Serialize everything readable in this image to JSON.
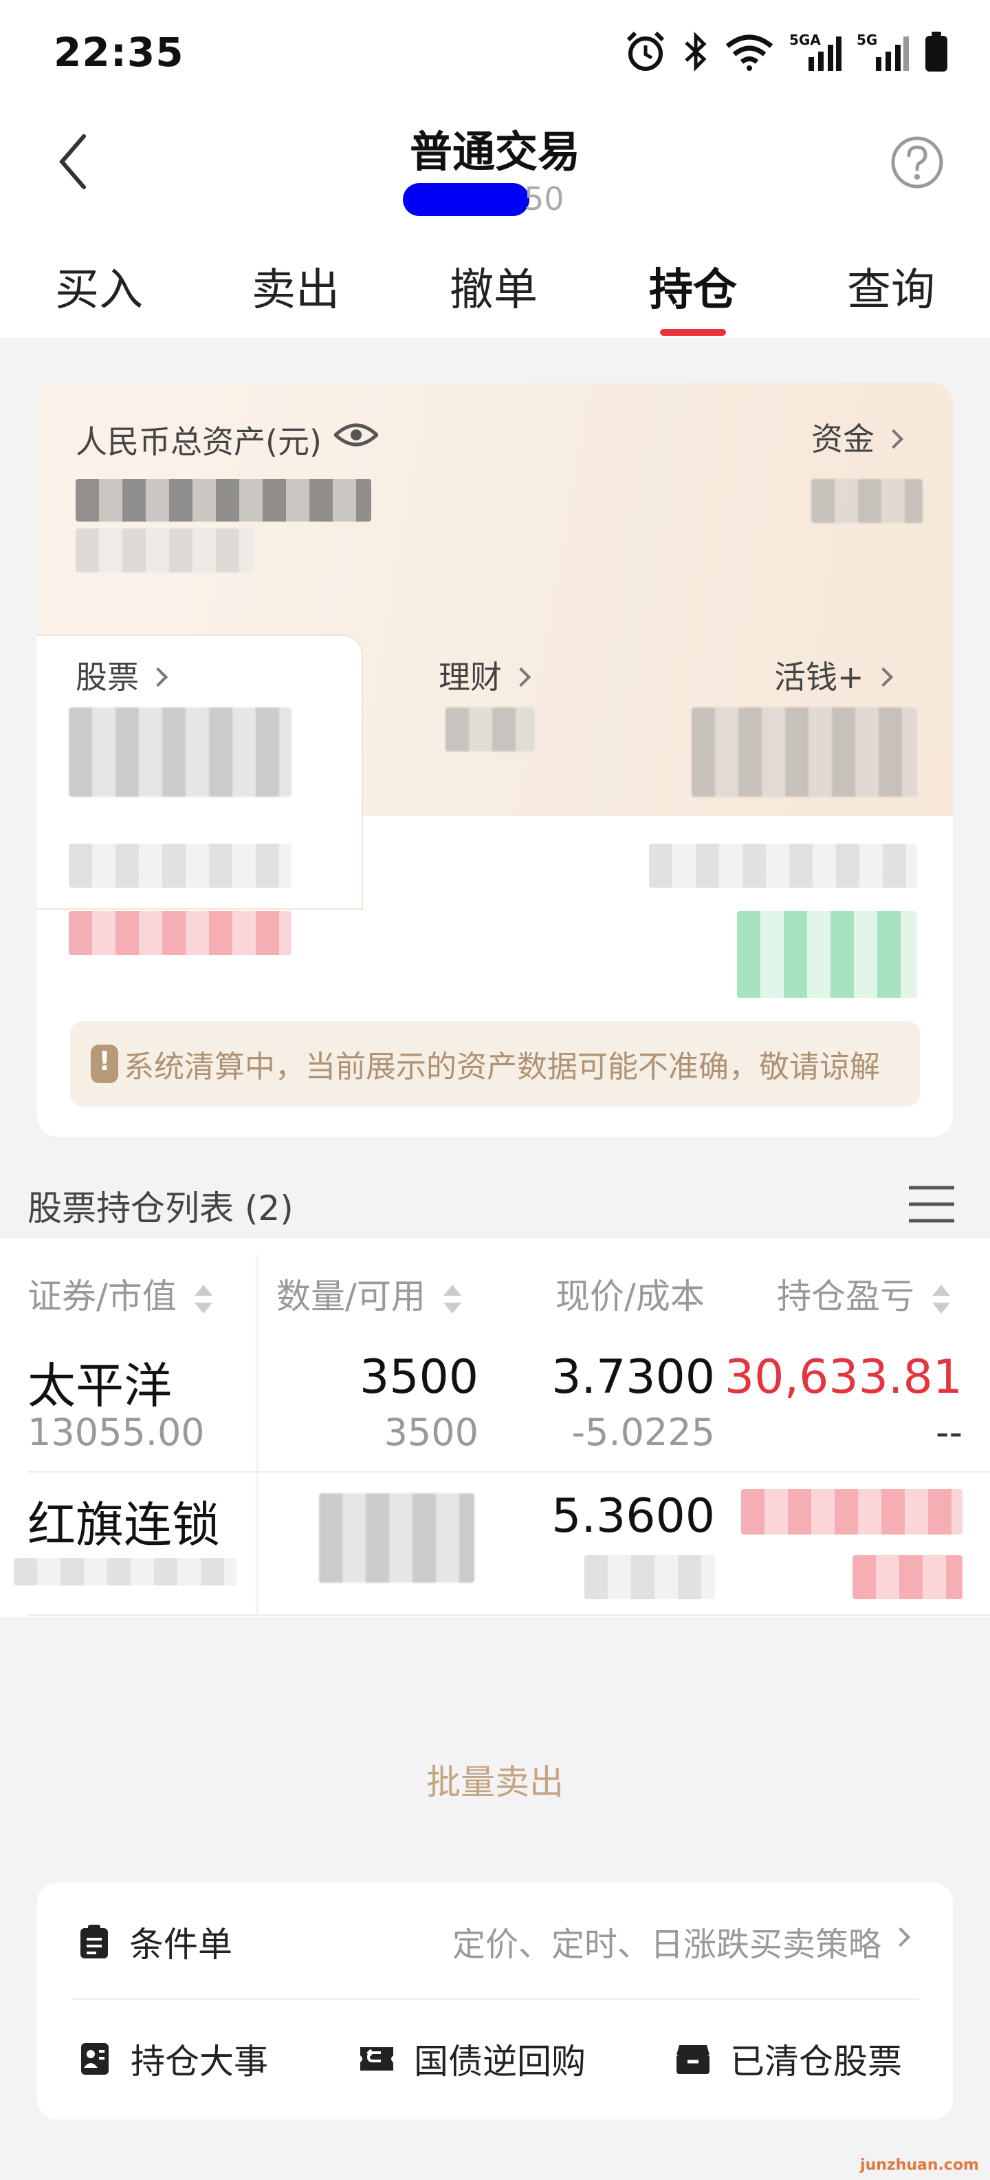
{
  "status_bar": {
    "time": "22:35",
    "network1": "5GA",
    "network2": "5G"
  },
  "header": {
    "title": "普通交易",
    "account_suffix": "50"
  },
  "tabs": [
    {
      "label": "买入"
    },
    {
      "label": "卖出"
    },
    {
      "label": "撤单"
    },
    {
      "label": "持仓",
      "active": true
    },
    {
      "label": "查询"
    }
  ],
  "asset_card": {
    "total_label": "人民币总资产(元)",
    "funds_label": "资金",
    "stock_label": "股票",
    "wealth_label": "理财",
    "cash_label": "活钱+",
    "notice": "系统清算中，当前展示的资产数据可能不准确，敬请谅解"
  },
  "holdings": {
    "title": "股票持仓列表 (2)",
    "columns": [
      "证券/市值",
      "数量/可用",
      "现价/成本",
      "持仓盈亏"
    ],
    "rows": [
      {
        "name": "太平洋",
        "market_value": "13055.00",
        "quantity": "3500",
        "available": "3500",
        "price": "3.7300",
        "cost": "-5.0225",
        "pnl": "30,633.81",
        "pnl_ratio": "--"
      },
      {
        "name": "红旗连锁",
        "price": "5.3600"
      }
    ]
  },
  "batch_sell_label": "批量卖出",
  "tools": {
    "conditional_label": "条件单",
    "conditional_desc": "定价、定时、日涨跌买卖策略",
    "events_label": "持仓大事",
    "repo_label": "国债逆回购",
    "cleared_label": "已清仓股票"
  },
  "watermark": "junzhuan.com",
  "colors": {
    "accent_red": "#e3353f",
    "gold": "#c5a481",
    "mask_blue": "#0000f5",
    "gain_green": "#6fd29e"
  }
}
